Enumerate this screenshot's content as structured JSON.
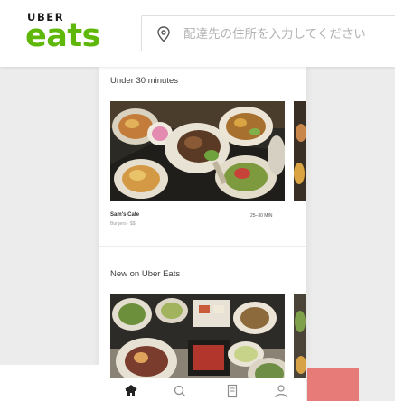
{
  "brand": {
    "uber": "UBER",
    "eats": "eats",
    "brand_green": "#5fb709"
  },
  "search": {
    "icon": "location-pin-icon",
    "placeholder": "配達先の住所を入力してください"
  },
  "feed": {
    "sections": [
      {
        "title": "Under 30 minutes",
        "restaurant": {
          "name": "Sam's Cafe",
          "meta": "Burgers · $$",
          "eta": "25–30 MIN"
        }
      },
      {
        "title": "New on Uber Eats"
      }
    ]
  },
  "tabbar": {
    "items": [
      {
        "icon": "home-icon",
        "active": true
      },
      {
        "icon": "search-icon",
        "active": false
      },
      {
        "icon": "orders-icon",
        "active": false
      },
      {
        "icon": "account-icon",
        "active": false
      }
    ]
  },
  "colors": {
    "background": "#ececec",
    "accent_block": "#e77b78"
  }
}
